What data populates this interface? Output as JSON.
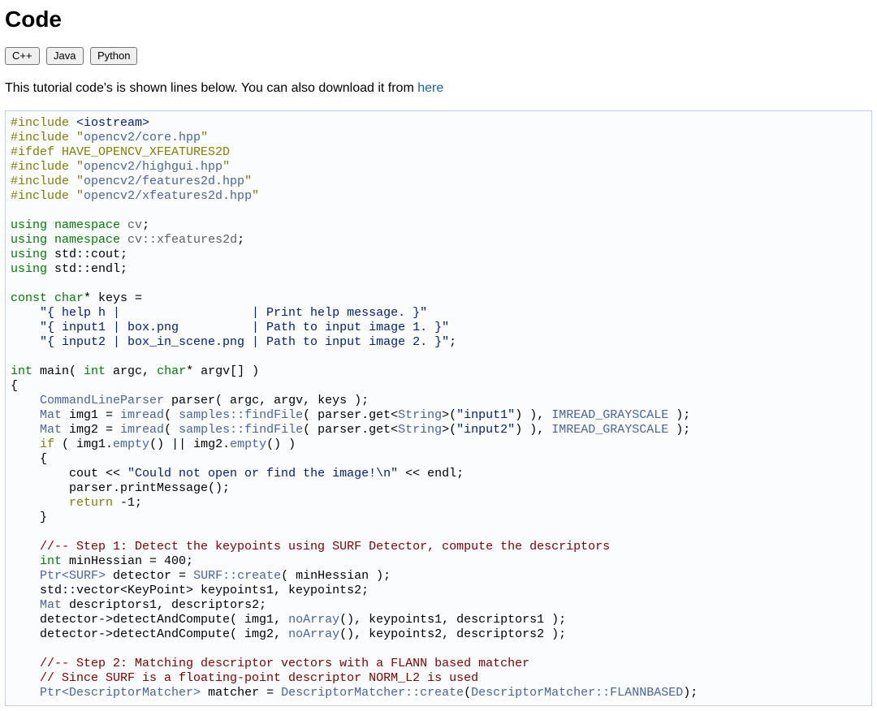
{
  "heading": "Code",
  "tabs": [
    "C++",
    "Java",
    "Python"
  ],
  "intro_text": "This tutorial code's is shown lines below. You can also download it from ",
  "intro_link": "here",
  "code": {
    "l1": {
      "pp": "#include ",
      "inc": "<iostream>"
    },
    "l2": {
      "pp": "#include ",
      "q1": "\"",
      "path": "opencv2/core.hpp",
      "q2": "\""
    },
    "l3": {
      "pp": "#ifdef HAVE_OPENCV_XFEATURES2D"
    },
    "l4": {
      "pp": "#include ",
      "q1": "\"",
      "path": "opencv2/highgui.hpp",
      "q2": "\""
    },
    "l5": {
      "pp": "#include ",
      "q1": "\"",
      "path": "opencv2/features2d.hpp",
      "q2": "\""
    },
    "l6": {
      "pp": "#include ",
      "q1": "\"",
      "path": "opencv2/xfeatures2d.hpp",
      "q2": "\""
    },
    "l7": "",
    "l8": {
      "kw": "using namespace",
      "sp": " ",
      "ns": "cv",
      "semi": ";"
    },
    "l9": {
      "kw": "using namespace",
      "sp": " ",
      "ns": "cv::xfeatures2d",
      "semi": ";"
    },
    "l10": {
      "kw": "using",
      "rest": " std::cout;"
    },
    "l11": {
      "kw": "using",
      "rest": " std::endl;"
    },
    "l12": "",
    "l13": {
      "kw1": "const",
      "sp1": " ",
      "kw2": "char",
      "rest": "* keys ="
    },
    "l14": "    \"{ help h |                  | Print help message. }\"",
    "l15": "    \"{ input1 | box.png          | Path to input image 1. }\"",
    "l16": {
      "str": "    \"{ input2 | box_in_scene.png | Path to input image 2. }\"",
      "semi": ";"
    },
    "l17": "",
    "l18": {
      "kw1": "int",
      "t1": " main( ",
      "kw2": "int",
      "t2": " argc, ",
      "kw3": "char",
      "t3": "* argv[] )"
    },
    "l19": "{",
    "l20": {
      "ind": "    ",
      "typ": "CommandLineParser",
      "rest": " parser( argc, argv, keys );"
    },
    "l21": {
      "ind": "    ",
      "typ": "Mat",
      "t1": " img1 = ",
      "fn": "imread",
      "t2": "( ",
      "fn2": "samples::findFile",
      "t3": "( parser.get<",
      "typ2": "String",
      "t4": ">(",
      "str": "\"input1\"",
      "t5": ") ), ",
      "typ3": "IMREAD_GRAYSCALE",
      "t6": " );"
    },
    "l22": {
      "ind": "    ",
      "typ": "Mat",
      "t1": " img2 = ",
      "fn": "imread",
      "t2": "( ",
      "fn2": "samples::findFile",
      "t3": "( parser.get<",
      "typ2": "String",
      "t4": ">(",
      "str": "\"input2\"",
      "t5": ") ), ",
      "typ3": "IMREAD_GRAYSCALE",
      "t6": " );"
    },
    "l23": {
      "ind": "    ",
      "kw": "if",
      "t1": " ( img1.",
      "fn": "empty",
      "t2": "() || img2.",
      "fn2": "empty",
      "t3": "() )"
    },
    "l24": "    {",
    "l25": {
      "ind": "        ",
      "t1": "cout << ",
      "str": "\"Could not open or find the image!\\n\"",
      "t2": " << endl;"
    },
    "l26": "        parser.printMessage();",
    "l27": {
      "ind": "        ",
      "kw": "return",
      "rest": " -1;"
    },
    "l28": "    }",
    "l29": "",
    "l30": "    //-- Step 1: Detect the keypoints using SURF Detector, compute the descriptors",
    "l31": {
      "ind": "    ",
      "kw": "int",
      "rest": " minHessian = 400;"
    },
    "l32": {
      "ind": "    ",
      "typ": "Ptr<SURF>",
      "t1": " detector = ",
      "fn": "SURF::create",
      "t2": "( minHessian );"
    },
    "l33": "    std::vector<KeyPoint> keypoints1, keypoints2;",
    "l34": {
      "ind": "    ",
      "typ": "Mat",
      "rest": " descriptors1, descriptors2;"
    },
    "l35": {
      "ind": "    ",
      "t1": "detector->detectAndCompute( img1, ",
      "fn": "noArray",
      "t2": "(), keypoints1, descriptors1 );"
    },
    "l36": {
      "ind": "    ",
      "t1": "detector->detectAndCompute( img2, ",
      "fn": "noArray",
      "t2": "(), keypoints2, descriptors2 );"
    },
    "l37": "",
    "l38": "    //-- Step 2: Matching descriptor vectors with a FLANN based matcher",
    "l39": "    // Since SURF is a floating-point descriptor NORM_L2 is used",
    "l40": {
      "ind": "    ",
      "typ": "Ptr<DescriptorMatcher>",
      "t1": " matcher = ",
      "fn": "DescriptorMatcher::create",
      "t2": "(",
      "typ2": "DescriptorMatcher::FLANNBASED",
      "t3": ");"
    }
  }
}
